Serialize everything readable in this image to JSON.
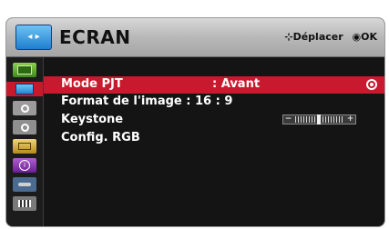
{
  "header": {
    "title": "ECRAN",
    "move_hint": "Déplacer",
    "ok_hint": "OK",
    "icon": "screen-icon"
  },
  "sidebar": {
    "items": [
      {
        "icon": "picture-icon",
        "active": false
      },
      {
        "icon": "screen-icon",
        "active": true
      },
      {
        "icon": "audio-icon",
        "active": false
      },
      {
        "icon": "clock-icon",
        "active": false
      },
      {
        "icon": "options-icon",
        "active": false
      },
      {
        "icon": "info-icon",
        "active": false
      },
      {
        "icon": "input-icon",
        "active": false
      },
      {
        "icon": "media-icon",
        "active": false
      }
    ]
  },
  "menu": {
    "items": [
      {
        "label": "Mode PJT",
        "value": ": Avant"
      },
      {
        "label": "Format de l'image : 16 : 9",
        "value": ""
      },
      {
        "label": "Keystone",
        "value": ""
      },
      {
        "label": "Config. RGB",
        "value": ""
      }
    ]
  },
  "keystone": {
    "level": 0.5
  },
  "colors": {
    "accent": "#c81a2e",
    "panel_bg": "#141414",
    "header_bg": "#b8b8b8"
  }
}
